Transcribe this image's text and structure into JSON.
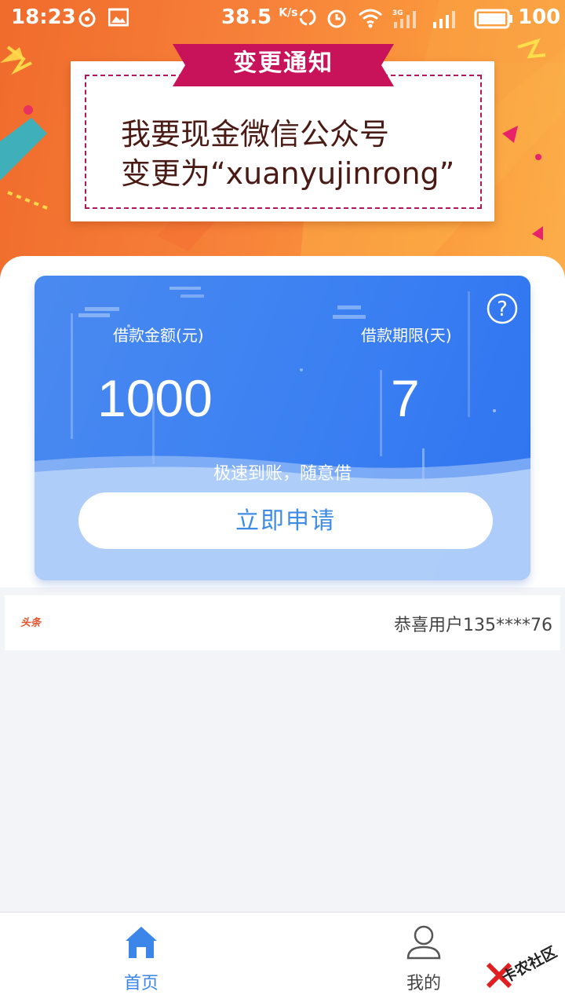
{
  "status_bar": {
    "time": "18:23",
    "speed": "38.5",
    "speed_unit": "K/s",
    "network": "3G",
    "battery": "100"
  },
  "notice": {
    "ribbon_title": "变更通知",
    "line1": "我要现金微信公众号",
    "line2": "变更为“xuanyujinrong”"
  },
  "loan_card": {
    "amount_label": "借款金额(元)",
    "amount_value": "1000",
    "term_label": "借款期限(天)",
    "term_value": "7",
    "slogan": "极速到账，随意借",
    "apply_label": "立即申请"
  },
  "ticker": {
    "tag": "头条",
    "text": "恭喜用户135****76"
  },
  "tabbar": {
    "home_label": "首页",
    "mine_label": "我的"
  },
  "watermark": {
    "text": "卡农社区"
  },
  "colors": {
    "header_orange": "#f7823a",
    "card_blue": "#3b80f2",
    "accent_blue": "#3b86e8",
    "ribbon_red": "#c8135a"
  }
}
